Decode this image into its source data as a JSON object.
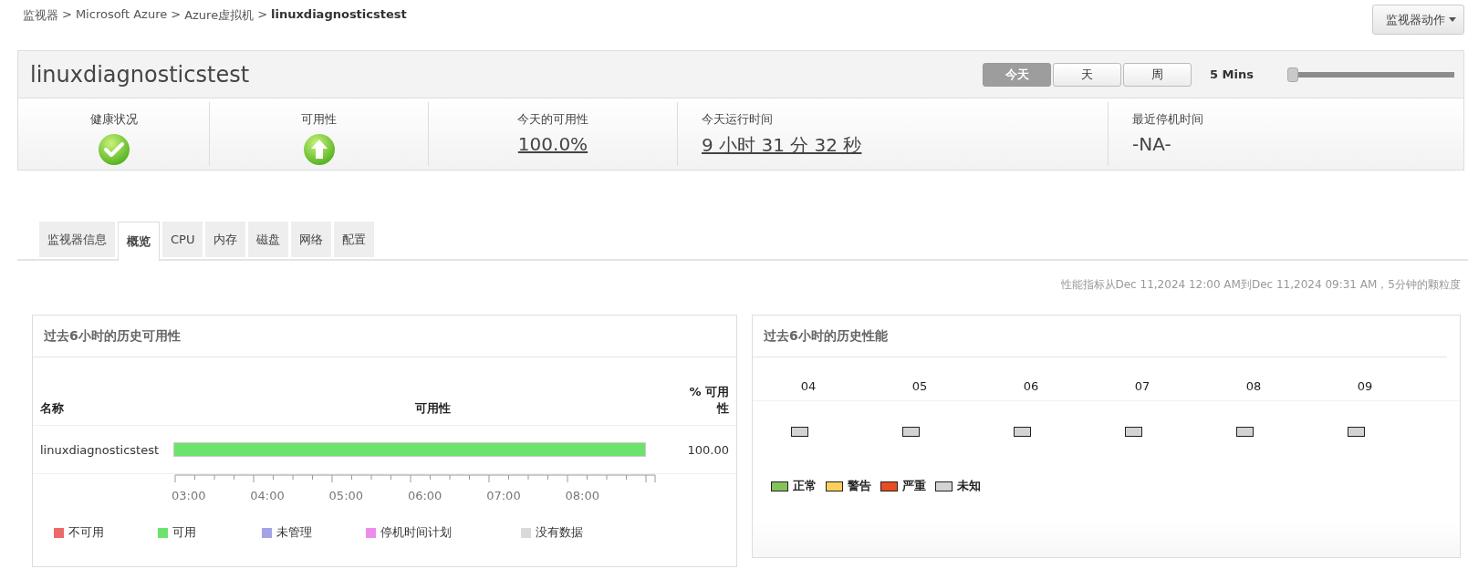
{
  "breadcrumb": {
    "separator": ">",
    "items": [
      "监视器",
      "Microsoft Azure",
      "Azure虚拟机",
      "linuxdiagnosticstest"
    ]
  },
  "actions_button": "监视器动作",
  "monitor": {
    "title": "linuxdiagnosticstest",
    "periods": [
      {
        "label": "今天",
        "selected": true
      },
      {
        "label": "天",
        "selected": false
      },
      {
        "label": "周",
        "selected": false
      }
    ],
    "granularity": "5 Mins",
    "slider": {
      "level": 0
    },
    "stats": [
      {
        "label": "健康状况",
        "kind": "health"
      },
      {
        "label": "可用性",
        "kind": "availability"
      },
      {
        "label": "今天的可用性",
        "kind": "link",
        "value": "100.0%"
      },
      {
        "label": "今天运行时间",
        "kind": "link",
        "value": "9 小时 31 分 32 秒"
      },
      {
        "label": "最近停机时间",
        "kind": "text",
        "value": "-NA-"
      }
    ]
  },
  "tabs": [
    {
      "label": "监视器信息",
      "selected": false
    },
    {
      "label": "概览",
      "selected": true
    },
    {
      "label": "CPU",
      "selected": false
    },
    {
      "label": "内存",
      "selected": false
    },
    {
      "label": "磁盘",
      "selected": false
    },
    {
      "label": "网络",
      "selected": false
    },
    {
      "label": "配置",
      "selected": false
    }
  ],
  "period_note": "性能指标从Dec 11,2024 12:00 AM到Dec 11,2024 09:31 AM，5分钟的颗粒度",
  "availability_panel": {
    "title": "过去6小时的历史可用性",
    "columns": [
      "名称",
      "可用性",
      "% 可用性"
    ],
    "rows": [
      {
        "name": "linuxdiagnosticstest",
        "segments": [
          {
            "color": "#6de36d"
          }
        ],
        "percent": "100.00"
      }
    ],
    "axis": [
      "03:00",
      "04:00",
      "05:00",
      "06:00",
      "07:00",
      "08:00"
    ],
    "legend": [
      {
        "label": "不可用",
        "color": "#ec6a6a"
      },
      {
        "label": "可用",
        "color": "#6de36d"
      },
      {
        "label": "未管理",
        "color": "#a3a3e8"
      },
      {
        "label": "停机时间计划",
        "color": "#ee8cee"
      },
      {
        "label": "没有数据",
        "color": "#d9d9d9"
      }
    ]
  },
  "performance_panel": {
    "title": "过去6小时的历史性能",
    "hours": [
      {
        "label": "04",
        "color": "#d3d3d3"
      },
      {
        "label": "05",
        "color": "#d3d3d3"
      },
      {
        "label": "06",
        "color": "#d3d3d3"
      },
      {
        "label": "07",
        "color": "#d3d3d3"
      },
      {
        "label": "08",
        "color": "#d3d3d3"
      },
      {
        "label": "09",
        "color": "#d3d3d3"
      }
    ],
    "legend": [
      {
        "label": "正常",
        "color": "#84c35a"
      },
      {
        "label": "警告",
        "color": "#fdd05c"
      },
      {
        "label": "严重",
        "color": "#e84c22"
      },
      {
        "label": "未知",
        "color": "#d3d3d3"
      }
    ]
  }
}
